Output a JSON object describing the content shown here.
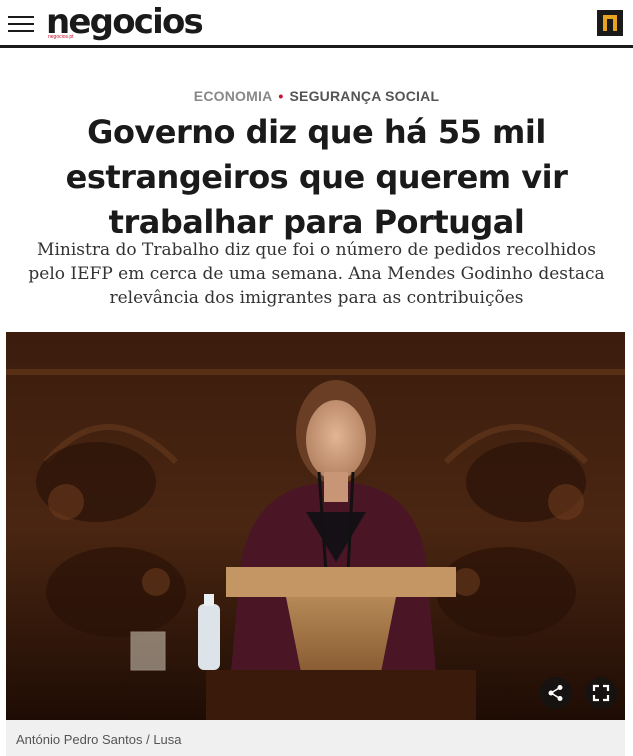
{
  "header": {
    "logo_text": "negocios",
    "logo_sub": "negocios.pt",
    "menu_icon": "hamburger-icon",
    "brand_icon": "brand-badge-icon"
  },
  "article": {
    "category": "ECONOMIA",
    "subcategory": "SEGURANÇA SOCIAL",
    "headline": "Governo diz que há 55 mil estrangeiros que querem vir trabalhar para Portugal",
    "lead": "Ministra do Trabalho diz que foi o número de pedidos recolhidos pelo IEFP em cerca de uma semana. Ana Mendes Godinho destaca relevância dos imigrantes para as contribuições",
    "photo_credit": "António Pedro Santos / Lusa"
  },
  "photo_controls": {
    "share_icon": "share-icon",
    "fullscreen_icon": "fullscreen-icon"
  },
  "colors": {
    "accent": "#c8102e",
    "brand_gold": "#e8a320",
    "text": "#1a1a1a"
  }
}
